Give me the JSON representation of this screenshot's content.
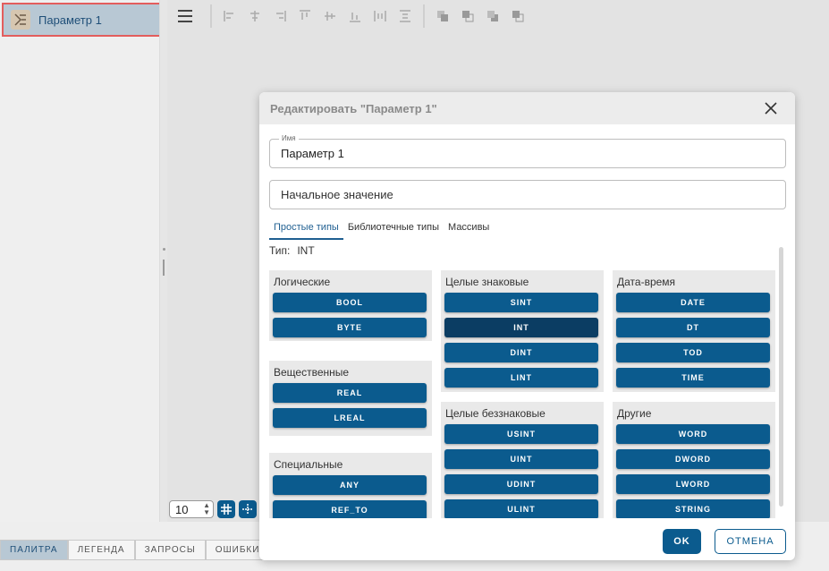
{
  "sidebar": {
    "item_label": "Параметр 1",
    "item_icon": "function-block-icon"
  },
  "toolbar": {
    "menu_icon": "hamburger-icon",
    "align_icons": [
      "align-left-icon",
      "align-center-h-icon",
      "align-right-icon",
      "align-top-icon",
      "align-middle-v-icon",
      "align-bottom-icon",
      "distribute-h-icon",
      "distribute-v-icon"
    ],
    "order_icons": [
      "bring-front-icon",
      "bring-forward-icon",
      "send-backward-icon",
      "send-back-icon"
    ]
  },
  "zoom": {
    "value": "10"
  },
  "bottom_tabs": [
    "ПАЛИТРА",
    "ЛЕГЕНДА",
    "ЗАПРОСЫ",
    "ОШИБКИ"
  ],
  "dialog": {
    "title": "Редактировать \"Параметр 1\"",
    "name_legend": "Имя",
    "name_value": "Параметр 1",
    "initial_placeholder": "Начальное значение",
    "tabs": [
      "Простые типы",
      "Библиотечные типы",
      "Массивы"
    ],
    "type_label": "Тип:",
    "type_value": "INT",
    "groups": {
      "logical": {
        "title": "Логические",
        "items": [
          "BOOL",
          "BYTE"
        ]
      },
      "real": {
        "title": "Вещественные",
        "items": [
          "REAL",
          "LREAL"
        ]
      },
      "special": {
        "title": "Специальные",
        "items": [
          "ANY",
          "REF_TO"
        ]
      },
      "signed": {
        "title": "Целые знаковые",
        "items": [
          "SINT",
          "INT",
          "DINT",
          "LINT"
        ]
      },
      "unsigned": {
        "title": "Целые беззнаковые",
        "items": [
          "USINT",
          "UINT",
          "UDINT",
          "ULINT"
        ]
      },
      "datetime": {
        "title": "Дата-время",
        "items": [
          "DATE",
          "DT",
          "TOD",
          "TIME"
        ]
      },
      "other": {
        "title": "Другие",
        "items": [
          "WORD",
          "DWORD",
          "LWORD",
          "STRING"
        ]
      }
    },
    "ok_label": "OK",
    "cancel_label": "ОТМЕНА"
  },
  "colors": {
    "accent": "#0b5b8e",
    "selected": "#0b3d63",
    "highlight": "#e35d5d"
  }
}
